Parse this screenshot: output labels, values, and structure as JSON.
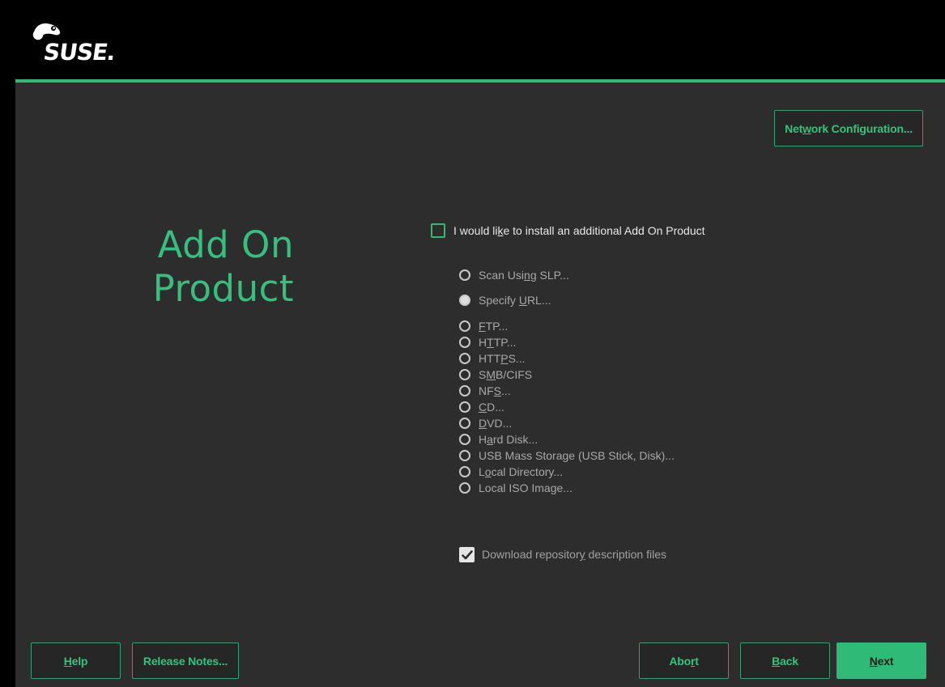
{
  "brand": {
    "logo_text": "SUSE.",
    "accent_color": "#30ba78",
    "background_color": "#2d2d2d"
  },
  "header": {
    "network_config_label": {
      "pre": "Net",
      "key": "w",
      "post": "ork Configuration..."
    }
  },
  "page": {
    "title_line1": "Add On",
    "title_line2": "Product"
  },
  "addon": {
    "checkbox_checked": false,
    "checkbox_label": {
      "pre": "I would li",
      "key": "k",
      "post": "e to install an additional Add On Product"
    }
  },
  "sources": {
    "group_top": [
      {
        "pre": "Scan Usi",
        "key": "n",
        "post": "g SLP...",
        "selected": false
      },
      {
        "pre": "Specify ",
        "key": "U",
        "post": "RL...",
        "selected": true
      }
    ],
    "group_url": [
      {
        "pre": "",
        "key": "F",
        "post": "TP..."
      },
      {
        "pre": "H",
        "key": "T",
        "post": "TP..."
      },
      {
        "pre": "HTT",
        "key": "P",
        "post": "S..."
      },
      {
        "pre": "S",
        "key": "M",
        "post": "B/CIFS"
      },
      {
        "pre": "NF",
        "key": "S",
        "post": "..."
      },
      {
        "pre": "",
        "key": "C",
        "post": "D..."
      },
      {
        "pre": "",
        "key": "D",
        "post": "VD..."
      },
      {
        "pre": "H",
        "key": "a",
        "post": "rd Disk..."
      },
      {
        "pre": "USB Mass Stora",
        "key": "g",
        "post": "e (USB Stick, Disk)..."
      },
      {
        "pre": "L",
        "key": "o",
        "post": "cal Directory..."
      },
      {
        "pre": "Local ISO Ima",
        "key": "g",
        "post": "e..."
      }
    ]
  },
  "download": {
    "checked": true,
    "label": {
      "pre": "Download repositor",
      "key": "y",
      "post": " description files"
    }
  },
  "footer": {
    "help": {
      "pre": "",
      "key": "H",
      "post": "elp"
    },
    "release_notes": {
      "pre": "Release Notes...",
      "key": "",
      "post": ""
    },
    "abort": {
      "pre": "Abo",
      "key": "r",
      "post": "t"
    },
    "back": {
      "pre": "",
      "key": "B",
      "post": "ack"
    },
    "next": {
      "pre": "",
      "key": "N",
      "post": "ext"
    }
  }
}
